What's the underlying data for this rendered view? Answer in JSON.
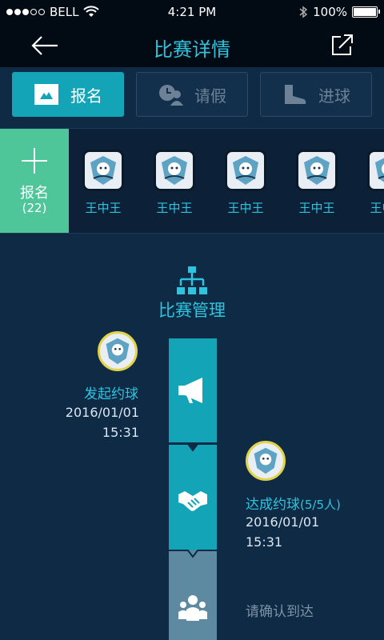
{
  "status_bar": {
    "carrier": "BELL",
    "time": "4:21 PM",
    "battery": "100%"
  },
  "nav": {
    "title": "比赛详情",
    "back_icon": "back-arrow-icon",
    "share_icon": "share-icon"
  },
  "tabs": [
    {
      "label": "报名",
      "icon": "signup-icon",
      "active": true
    },
    {
      "label": "请假",
      "icon": "leave-icon",
      "active": false
    },
    {
      "label": "进球",
      "icon": "goal-boot-icon",
      "active": false
    }
  ],
  "join": {
    "label": "报名",
    "count": "(22)"
  },
  "members": [
    {
      "name": "王中王"
    },
    {
      "name": "王中王"
    },
    {
      "name": "王中王"
    },
    {
      "name": "王中王"
    },
    {
      "name": "王中王"
    }
  ],
  "section": {
    "title": "比赛管理",
    "icon": "org-chart-icon"
  },
  "timeline": [
    {
      "title": "发起约球",
      "date": "2016/01/01",
      "time": "15:31",
      "icon": "megaphone-icon"
    },
    {
      "title": "达成约球",
      "extra": "(5/5人)",
      "date": "2016/01/01",
      "time": "15:31",
      "icon": "handshake-icon"
    },
    {
      "title": "请确认到达",
      "icon": "group-icon"
    }
  ],
  "colors": {
    "accent": "#2fc4de",
    "active_tab": "#14a4b8",
    "join_green": "#4fc59a",
    "badge_ring": "#e2d44a"
  }
}
